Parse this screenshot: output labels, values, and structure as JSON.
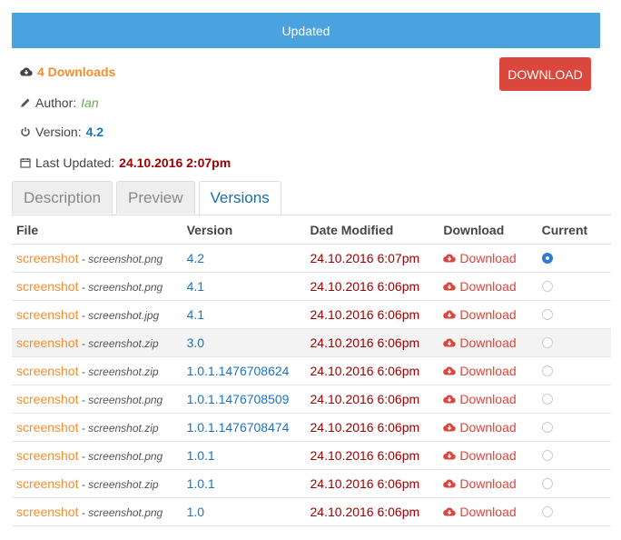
{
  "banner": "Updated",
  "summary": {
    "downloads": "4 Downloads",
    "author_label": "Author:",
    "author": "Ian",
    "version_label": "Version:",
    "version": "4.2",
    "updated_label": "Last Updated:",
    "updated": "24.10.2016 2:07pm"
  },
  "download_button": "DOWNLOAD",
  "tabs": [
    "Description",
    "Preview",
    "Versions"
  ],
  "active_tab": "Versions",
  "table": {
    "headers": [
      "File",
      "Version",
      "Date Modified",
      "Download",
      "Current"
    ],
    "rows": [
      {
        "name": "screenshot",
        "file": "screenshot.png",
        "version": "4.2",
        "date": "24.10.2016 6:07pm",
        "download": "Download",
        "current": true
      },
      {
        "name": "screenshot",
        "file": "screenshot.png",
        "version": "4.1",
        "date": "24.10.2016 6:06pm",
        "download": "Download",
        "current": false
      },
      {
        "name": "screenshot",
        "file": "screenshot.jpg",
        "version": "4.1",
        "date": "24.10.2016 6:06pm",
        "download": "Download",
        "current": false
      },
      {
        "name": "screenshot",
        "file": "screenshot.zip",
        "version": "3.0",
        "date": "24.10.2016 6:06pm",
        "download": "Download",
        "current": false
      },
      {
        "name": "screenshot",
        "file": "screenshot.zip",
        "version": "1.0.1.1476708624",
        "date": "24.10.2016 6:06pm",
        "download": "Download",
        "current": false
      },
      {
        "name": "screenshot",
        "file": "screenshot.png",
        "version": "1.0.1.1476708509",
        "date": "24.10.2016 6:06pm",
        "download": "Download",
        "current": false
      },
      {
        "name": "screenshot",
        "file": "screenshot.zip",
        "version": "1.0.1.1476708474",
        "date": "24.10.2016 6:06pm",
        "download": "Download",
        "current": false
      },
      {
        "name": "screenshot",
        "file": "screenshot.png",
        "version": "1.0.1",
        "date": "24.10.2016 6:06pm",
        "download": "Download",
        "current": false
      },
      {
        "name": "screenshot",
        "file": "screenshot.zip",
        "version": "1.0.1",
        "date": "24.10.2016 6:06pm",
        "download": "Download",
        "current": false
      },
      {
        "name": "screenshot",
        "file": "screenshot.png",
        "version": "1.0",
        "date": "24.10.2016 6:06pm",
        "download": "Download",
        "current": false
      }
    ]
  },
  "colors": {
    "banner": "#4aa3df",
    "accent_orange": "#f68d2e",
    "download_red": "#d9473d",
    "date_red": "#a10000",
    "link_blue": "#1a73c7"
  }
}
